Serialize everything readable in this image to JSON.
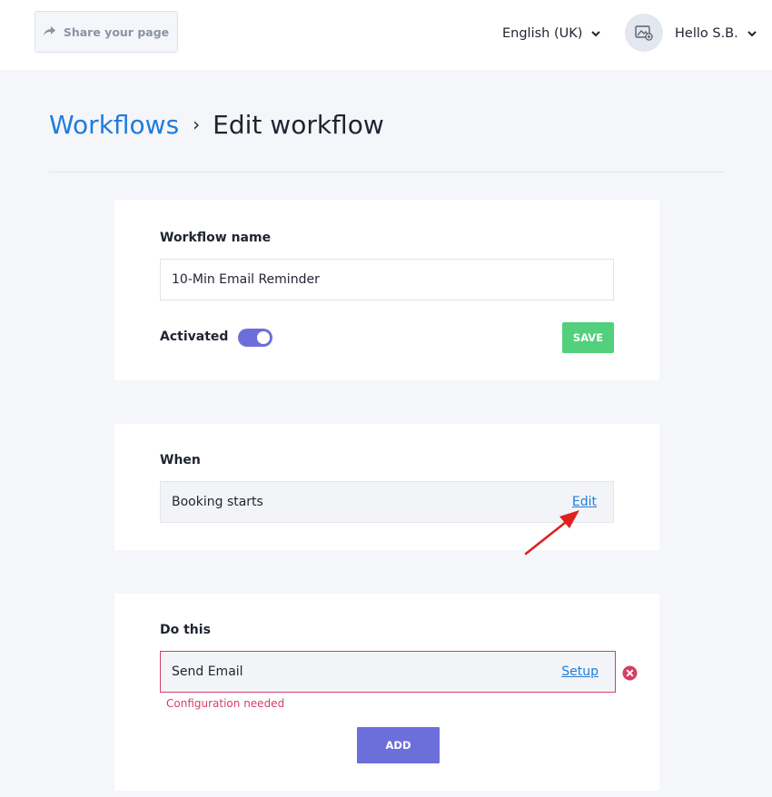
{
  "header": {
    "share_label": "Share your page",
    "language": "English (UK)",
    "user_greeting": "Hello S.B."
  },
  "breadcrumb": {
    "parent": "Workflows",
    "separator": "›",
    "current": "Edit workflow"
  },
  "workflow_card": {
    "name_label": "Workflow name",
    "name_value": "10-Min Email Reminder",
    "activated_label": "Activated",
    "activated": true,
    "save_label": "SAVE"
  },
  "when_card": {
    "label": "When",
    "trigger": "Booking starts",
    "edit_label": "Edit"
  },
  "do_card": {
    "label": "Do this",
    "action": "Send Email",
    "setup_label": "Setup",
    "error": "Configuration needed",
    "add_label": "ADD"
  },
  "colors": {
    "accent": "#6c6fd9",
    "link": "#1f7cdb",
    "save": "#52d07c",
    "error": "#d43f67",
    "annotation_arrow": "#e02020"
  },
  "icons": [
    "share-arrow-icon",
    "chevron-down-icon",
    "avatar-image-icon",
    "remove-circle-icon",
    "annotation-arrow"
  ]
}
